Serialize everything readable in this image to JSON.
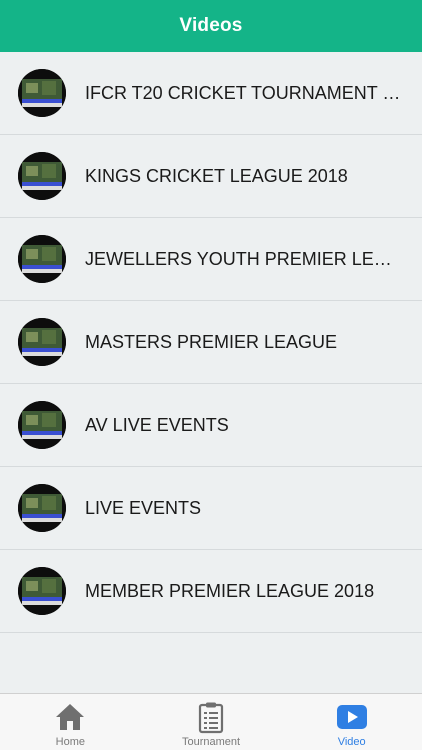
{
  "header": {
    "title": "Videos"
  },
  "videos": [
    {
      "label": "IFCR T20 CRICKET TOURNAMENT SE..."
    },
    {
      "label": "KINGS CRICKET LEAGUE 2018"
    },
    {
      "label": "JEWELLERS YOUTH PREMIER LEAGU..."
    },
    {
      "label": "MASTERS PREMIER LEAGUE"
    },
    {
      "label": "AV LIVE EVENTS"
    },
    {
      "label": "LIVE EVENTS"
    },
    {
      "label": "MEMBER PREMIER LEAGUE 2018"
    }
  ],
  "tabs": [
    {
      "label": "Home",
      "icon": "home-icon",
      "active": false
    },
    {
      "label": "Tournament",
      "icon": "clipboard-icon",
      "active": false
    },
    {
      "label": "Video",
      "icon": "play-icon",
      "active": true
    }
  ],
  "colors": {
    "header_bg": "#14b488",
    "active_tab": "#2f7fe3",
    "inactive_tab": "#6f6f6f"
  }
}
